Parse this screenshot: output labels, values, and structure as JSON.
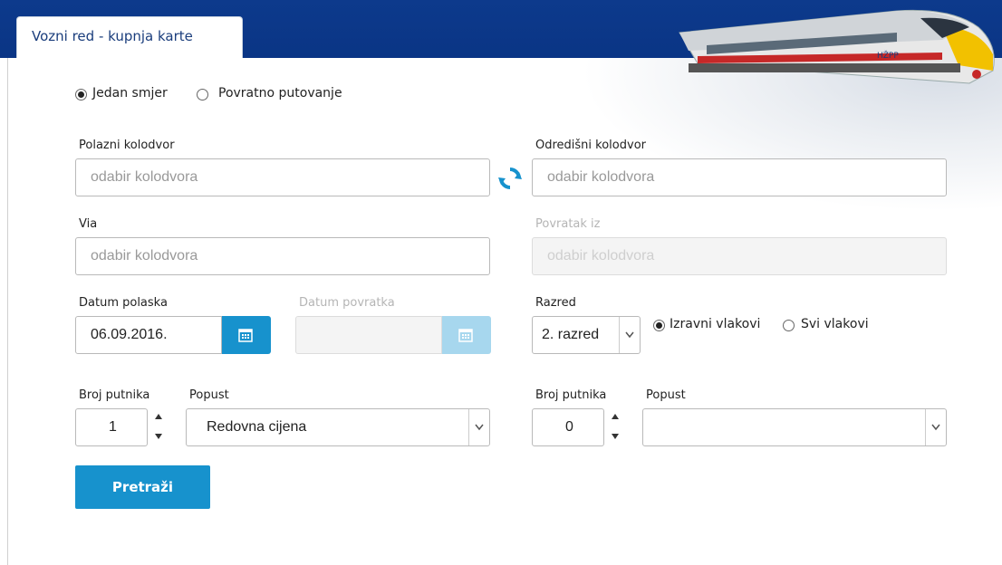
{
  "tab": {
    "title": "Vozni red - kupnja karte"
  },
  "trip_type": {
    "one_way": "Jedan smjer",
    "round_trip": "Povratno putovanje",
    "selected": "one_way"
  },
  "from": {
    "label": "Polazni kolodvor",
    "placeholder": "odabir kolodvora"
  },
  "to": {
    "label": "Odredišni kolodvor",
    "placeholder": "odabir kolodvora"
  },
  "via": {
    "label": "Via",
    "placeholder": "odabir kolodvora"
  },
  "return_from": {
    "label": "Povratak iz",
    "placeholder": "odabir kolodvora"
  },
  "departure_date": {
    "label": "Datum polaska",
    "value": "06.09.2016."
  },
  "return_date": {
    "label": "Datum povratka",
    "value": ""
  },
  "class": {
    "label": "Razred",
    "value": "2. razred"
  },
  "train_type": {
    "direct": "Izravni vlakovi",
    "all": "Svi vlakovi",
    "selected": "direct"
  },
  "passengers_1": {
    "label": "Broj putnika",
    "value": "1"
  },
  "discount_1": {
    "label": "Popust",
    "value": "Redovna cijena"
  },
  "passengers_2": {
    "label": "Broj putnika",
    "value": "0"
  },
  "discount_2": {
    "label": "Popust",
    "value": ""
  },
  "search_button": {
    "label": "Pretraži"
  },
  "train_logo_text": "HŽPP",
  "colors": {
    "header": "#0d3a8c",
    "accent": "#1792cd"
  }
}
